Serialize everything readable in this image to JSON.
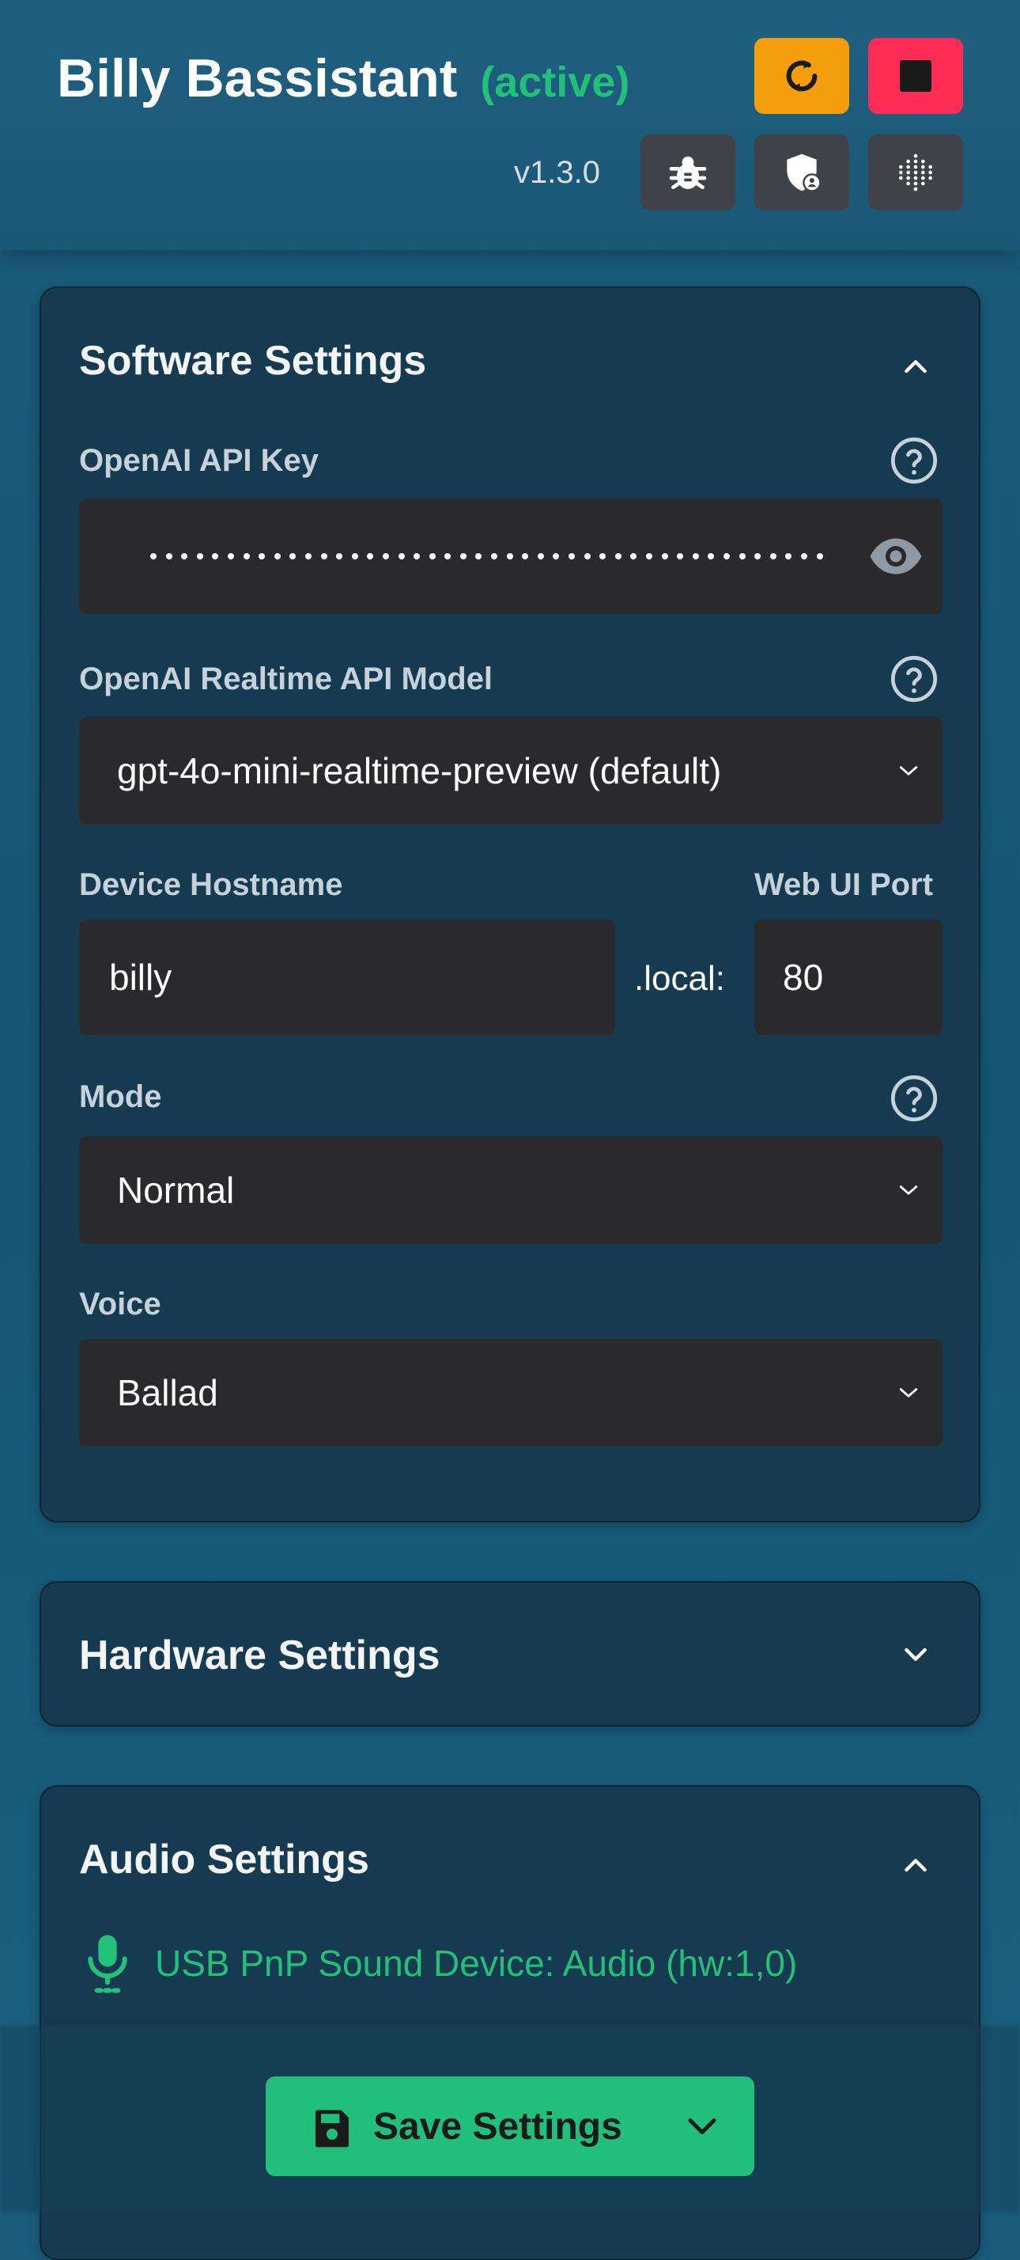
{
  "app": {
    "title": "Billy Bassistant",
    "status": "(active)",
    "version": "v1.3.0"
  },
  "header_buttons": [
    "restart-icon",
    "stop-icon",
    "bug-icon",
    "shield-user-icon",
    "grid-dots-icon"
  ],
  "software": {
    "title": "Software Settings",
    "api_key_label": "OpenAI API Key",
    "model_label": "OpenAI Realtime API Model",
    "model_value": "gpt-4o-mini-realtime-preview (default)",
    "hostname_label": "Device Hostname",
    "hostname_value": "billy",
    "local_suffix": ".local:",
    "port_label": "Web UI Port",
    "port_value": "80",
    "mode_label": "Mode",
    "mode_value": "Normal",
    "voice_label": "Voice",
    "voice_value": "Ballad"
  },
  "hardware": {
    "title": "Hardware Settings"
  },
  "audio": {
    "title": "Audio Settings",
    "device": "USB PnP Sound Device: Audio (hw:1,0)"
  },
  "save": {
    "label": "Save Settings"
  },
  "colors": {
    "accent": "#22bf7c",
    "orange": "#f59e0b",
    "red": "#ff2d55"
  }
}
